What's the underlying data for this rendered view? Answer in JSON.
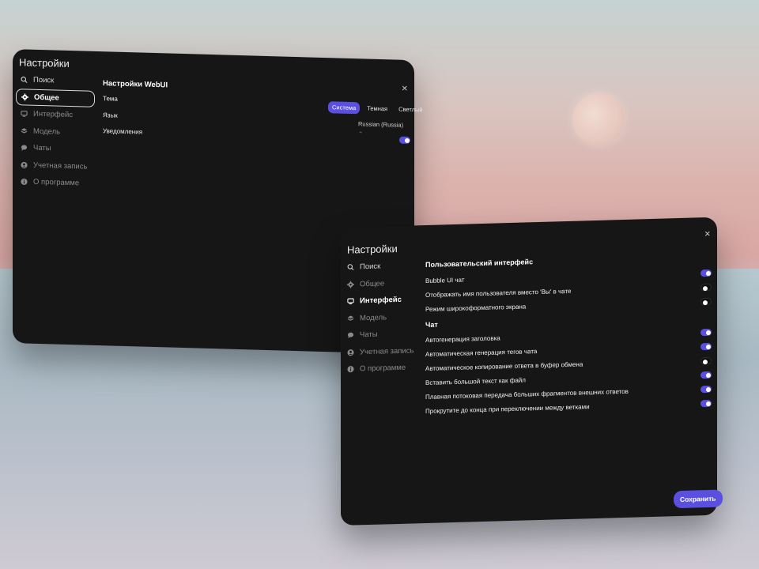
{
  "win1": {
    "title": "Настройки",
    "close": "×",
    "nav": [
      {
        "label": "Поиск",
        "icon": "search-icon"
      },
      {
        "label": "Общее",
        "icon": "gear-icon"
      },
      {
        "label": "Интерфейс",
        "icon": "monitor-icon"
      },
      {
        "label": "Модель",
        "icon": "cube-icon"
      },
      {
        "label": "Чаты",
        "icon": "chat-icon"
      },
      {
        "label": "Учетная запись",
        "icon": "user-icon"
      },
      {
        "label": "О программе",
        "icon": "info-icon"
      }
    ],
    "section_title": "Настройки WebUI",
    "theme_label": "Тема",
    "language_label": "Язык",
    "notifications_label": "Уведомления",
    "theme_options": [
      "Система",
      "Темная",
      "Светлый"
    ],
    "theme_selected": "Система",
    "language_value": "Russian (Russia)",
    "notifications_on": true
  },
  "win2": {
    "title": "Настройки",
    "close": "×",
    "nav": [
      {
        "label": "Поиск",
        "icon": "search-icon"
      },
      {
        "label": "Общее",
        "icon": "gear-icon"
      },
      {
        "label": "Интерфейс",
        "icon": "monitor-icon"
      },
      {
        "label": "Модель",
        "icon": "cube-icon"
      },
      {
        "label": "Чаты",
        "icon": "chat-icon"
      },
      {
        "label": "Учетная запись",
        "icon": "user-icon"
      },
      {
        "label": "О программе",
        "icon": "info-icon"
      }
    ],
    "ui_section": "Пользовательский интерфейс",
    "ui_rows": [
      {
        "label": "Bubble UI чат",
        "on": true
      },
      {
        "label": "Отображать имя пользователя вместо 'Вы' в чате",
        "on": false
      },
      {
        "label": "Режим широкоформатного экрана",
        "on": false
      }
    ],
    "chat_section": "Чат",
    "chat_rows": [
      {
        "label": "Автогенерация заголовка",
        "on": true
      },
      {
        "label": "Автоматическая генерация тегов чата",
        "on": true
      },
      {
        "label": "Автоматическое копирование ответа в буфер обмена",
        "on": false
      },
      {
        "label": "Вставить большой текст как файл",
        "on": true
      },
      {
        "label": "Плавная потоковая передача больших фрагментов внешних ответов",
        "on": true
      },
      {
        "label": "Прокрутите до конца при переключении между ветками",
        "on": true
      }
    ],
    "save_label": "Сохранить"
  },
  "colors": {
    "accent": "#5b4fe0",
    "panel": "#161616"
  }
}
